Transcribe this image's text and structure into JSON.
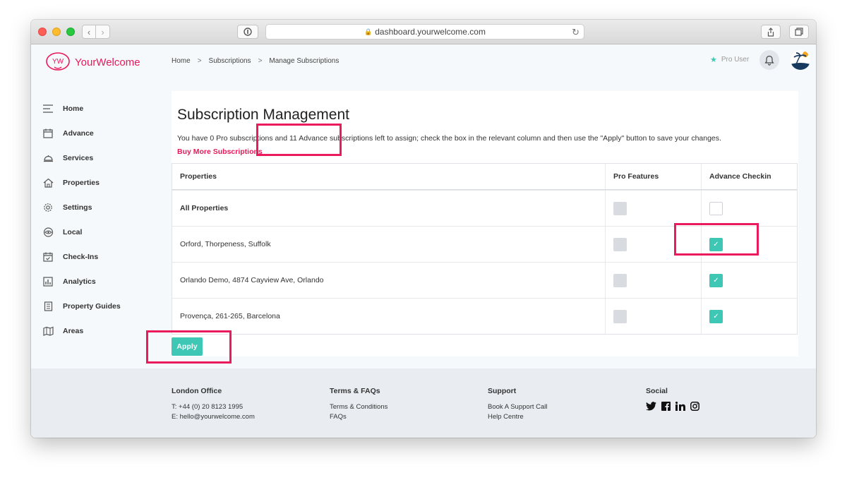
{
  "browser": {
    "url": "dashboard.yourwelcome.com"
  },
  "header": {
    "logo_mark": "YW",
    "logo_text": "YourWelcome",
    "breadcrumb": [
      "Home",
      "Subscriptions",
      "Manage Subscriptions"
    ],
    "breadcrumb_sep": ">",
    "pro_user": "Pro User"
  },
  "sidebar": {
    "items": [
      {
        "label": "Home",
        "icon": "menu-lines-icon"
      },
      {
        "label": "Advance",
        "icon": "calendar-icon"
      },
      {
        "label": "Services",
        "icon": "service-bell-icon"
      },
      {
        "label": "Properties",
        "icon": "house-icon"
      },
      {
        "label": "Settings",
        "icon": "gear-icon"
      },
      {
        "label": "Local",
        "icon": "eye-icon"
      },
      {
        "label": "Check-Ins",
        "icon": "calendar-check-icon"
      },
      {
        "label": "Analytics",
        "icon": "analytics-icon"
      },
      {
        "label": "Property Guides",
        "icon": "document-icon"
      },
      {
        "label": "Areas",
        "icon": "map-icon"
      }
    ]
  },
  "main": {
    "title": "Subscription Management",
    "description": "You have 0 Pro subscriptions and 11 Advance subscriptions left to assign; check the box in the relevant column and then use the \"Apply\" button to save your changes.",
    "buy_link": "Buy More Subscriptions",
    "table": {
      "headers": [
        "Properties",
        "Pro Features",
        "Advance Checkin"
      ],
      "rows": [
        {
          "property": "All Properties",
          "pro": "disabled",
          "advance": "unchecked"
        },
        {
          "property": "Orford, Thorpeness, Suffolk",
          "pro": "disabled",
          "advance": "checked"
        },
        {
          "property": "Orlando Demo, 4874 Cayview Ave, Orlando",
          "pro": "disabled",
          "advance": "checked"
        },
        {
          "property": "Provença, 261-265, Barcelona",
          "pro": "disabled",
          "advance": "checked"
        }
      ]
    },
    "apply_label": "Apply"
  },
  "footer": {
    "london": {
      "heading": "London Office",
      "phone": "T: +44 (0) 20 8123 1995",
      "email": "E: hello@yourwelcome.com"
    },
    "terms": {
      "heading": "Terms & FAQs",
      "links": [
        "Terms & Conditions",
        "FAQs"
      ]
    },
    "support": {
      "heading": "Support",
      "links": [
        "Book A Support Call",
        "Help Centre"
      ]
    },
    "social": {
      "heading": "Social",
      "icons": [
        "twitter-icon",
        "facebook-icon",
        "linkedin-icon",
        "instagram-icon"
      ]
    }
  },
  "colors": {
    "brand": "#e8195a",
    "accent": "#3ec7b5",
    "highlight": "#ea1a5c"
  }
}
